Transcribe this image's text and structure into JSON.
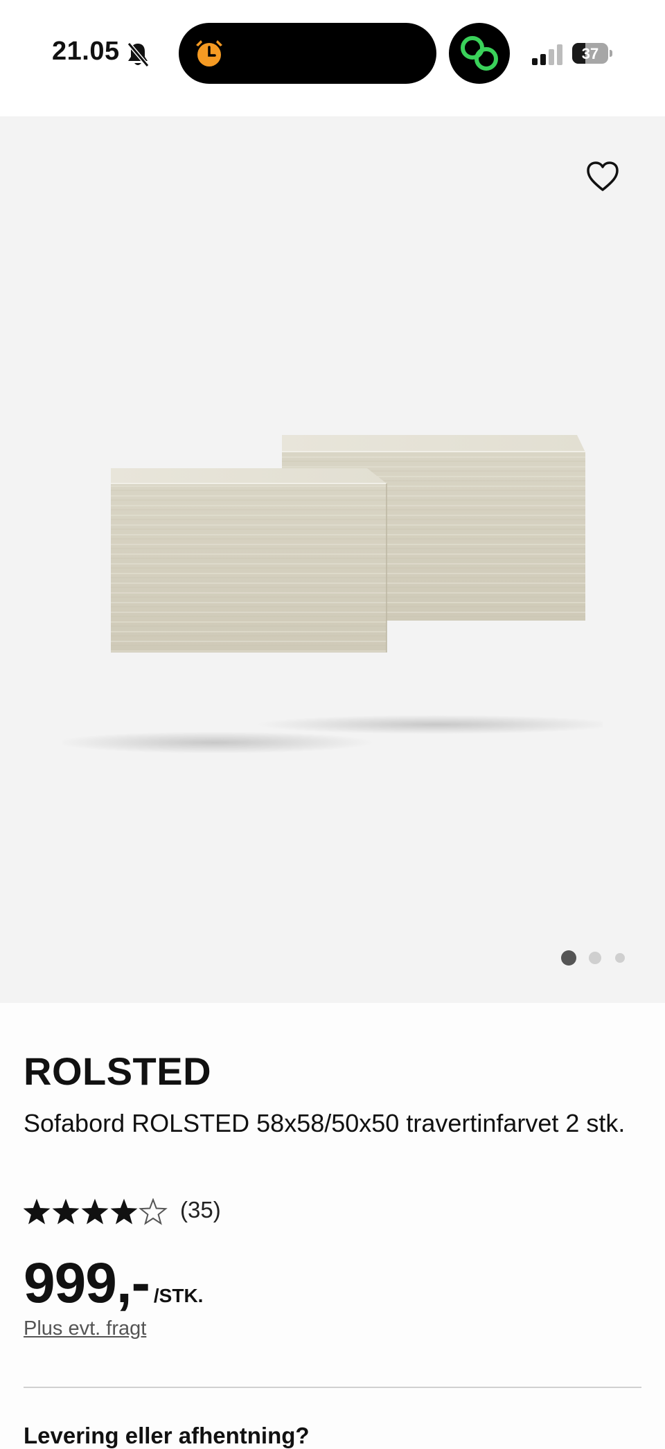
{
  "status_bar": {
    "time": "21.05",
    "battery_percent": "37",
    "battery_level": 0.37,
    "icons": [
      "bell-slash-icon",
      "alarm-clock-icon",
      "activity-rings-icon",
      "cellular-signal-icon",
      "battery-icon"
    ],
    "colors": {
      "alarm": "#f59a23",
      "activity": "#3ad15a"
    }
  },
  "gallery": {
    "favorite_icon": "heart-outline-icon",
    "image": "product-image-two-travertine-tables",
    "page_count": 3,
    "active_page": 1
  },
  "product": {
    "name": "ROLSTED",
    "description": "Sofabord ROLSTED 58x58/50x50 travertinfarvet 2 stk.",
    "rating": 4,
    "rating_max": 5,
    "review_count": "(35)",
    "price": "999,-",
    "price_unit": "/STK.",
    "shipping_link": "Plus evt. fragt"
  },
  "delivery": {
    "heading": "Levering eller afhentning?"
  }
}
